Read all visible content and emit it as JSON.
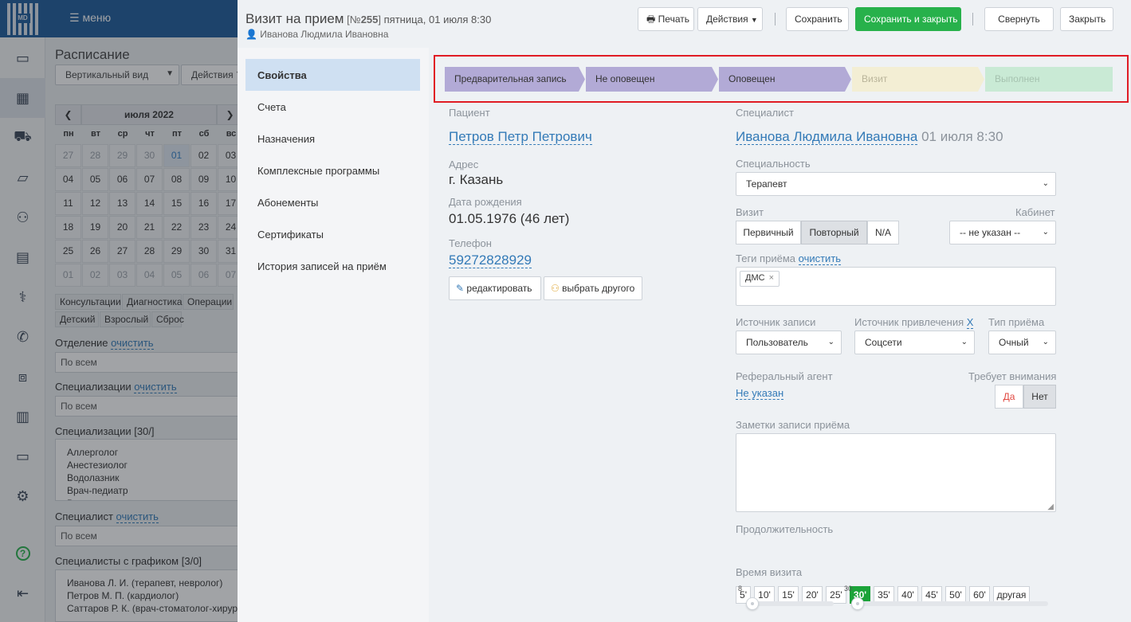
{
  "app": {
    "logo_text": "MD",
    "menu_label": "меню",
    "rail_icons": [
      "monitor-icon",
      "calendar-icon",
      "ambulance-icon",
      "banknote-icon",
      "users-icon",
      "book-icon",
      "stethoscope-icon",
      "phone-icon",
      "briefcase-icon",
      "chart-icon",
      "folder-icon",
      "gear-icon",
      "help-icon",
      "logout-icon"
    ]
  },
  "schedule": {
    "title": "Расписание",
    "view_select": "Вертикальный вид",
    "actions_select": "Действия",
    "calendar": {
      "month": "июля 2022",
      "weekdays": [
        "пн",
        "вт",
        "ср",
        "чт",
        "пт",
        "сб",
        "вс"
      ],
      "days": [
        [
          "27",
          "28",
          "29",
          "30",
          "01",
          "02",
          "03"
        ],
        [
          "04",
          "05",
          "06",
          "07",
          "08",
          "09",
          "10"
        ],
        [
          "11",
          "12",
          "13",
          "14",
          "15",
          "16",
          "17"
        ],
        [
          "18",
          "19",
          "20",
          "21",
          "22",
          "23",
          "24"
        ],
        [
          "25",
          "26",
          "27",
          "28",
          "29",
          "30",
          "31"
        ],
        [
          "01",
          "02",
          "03",
          "04",
          "05",
          "06",
          "07"
        ]
      ]
    },
    "chips_row1": [
      "Консультации",
      "Диагностика",
      "Операции"
    ],
    "chips_row2": [
      "Детский",
      "Взрослый",
      "Сброс"
    ],
    "department_label": "Отделение",
    "clear_label": "очистить",
    "department_value": "По всем",
    "specializations_label": "Специализации",
    "specializations_value": "По всем",
    "specializations_list_label": "Специализации [30/]",
    "specializations_list": [
      "Аллерголог",
      "Анестезиолог",
      "Водолазник",
      "Врач-педиатр",
      "Врач-стоматолог-хирург"
    ],
    "specialist_label": "Специалист",
    "specialist_value": "По всем",
    "specialists_schedule_label": "Специалисты с графиком [3/0]",
    "specialists_list": [
      "Иванова Л. И. (терапевт, невролог)",
      "Петров М. П. (кардиолог)",
      "Саттаров Р. К. (врач-стоматолог-хирург)"
    ]
  },
  "modal": {
    "title": "Визит на прием",
    "number_prefix": "[№",
    "number": "255",
    "number_suffix": "]",
    "date": "пятница, 01 июля 8:30",
    "doctor_subtitle": "Иванова Людмила Ивановна",
    "buttons": {
      "print": "Печать",
      "actions": "Действия",
      "save": "Сохранить",
      "save_close": "Сохранить и закрыть",
      "collapse": "Свернуть",
      "close": "Закрыть"
    },
    "nav": [
      "Свойства",
      "Счета",
      "Назначения",
      "Комплексные программы",
      "Абонементы",
      "Сертификаты",
      "История записей на приём"
    ],
    "stages": [
      {
        "label": "Предварительная запись",
        "color": "#b2aad6",
        "text_color": "#333333"
      },
      {
        "label": "Не оповещен",
        "color": "#b2aad6",
        "text_color": "#333333"
      },
      {
        "label": "Оповещен",
        "color": "#b2aad6",
        "text_color": "#333333"
      },
      {
        "label": "Визит",
        "color": "#f3eed4",
        "text_color": "#b9b49a"
      },
      {
        "label": "Выполнен",
        "color": "#c9ead5",
        "text_color": "#a5c2af"
      }
    ],
    "patient": {
      "label": "Пациент",
      "name": "Петров Петр Петрович",
      "address_label": "Адрес",
      "address": "г. Казань",
      "birth_label": "Дата рождения",
      "birth": "01.05.1976 (46 лет)",
      "phone_label": "Телефон",
      "phone": "59272828929",
      "edit_button": "редактировать",
      "choose_button": "выбрать другого"
    },
    "specialist": {
      "label": "Специалист",
      "name": "Иванова Людмила Ивановна",
      "time": "01 июля 8:30",
      "specialty_label": "Специальность",
      "specialty": "Терапевт",
      "visit_label": "Визит",
      "visit_options": [
        "Первичный",
        "Повторный",
        "N/A"
      ],
      "visit_selected": "Повторный",
      "cabinet_label": "Кабинет",
      "cabinet": "-- не указан --",
      "tags_label": "Теги приёма",
      "tags_clear": "очистить",
      "tags": [
        "ДМС"
      ],
      "source_label": "Источник записи",
      "source": "Пользователь",
      "attraction_label": "Источник привлечения",
      "attraction_clear": "X",
      "attraction": "Соцсети",
      "type_label": "Тип приёма",
      "type": "Очный",
      "referral_label": "Реферальный агент",
      "referral": "Не указан",
      "attention_label": "Требует внимания",
      "attention_yes": "Да",
      "attention_no": "Нет",
      "notes_label": "Заметки записи приёма",
      "duration_label": "Продолжительность",
      "durations": [
        "5'",
        "10'",
        "15'",
        "20'",
        "25'",
        "30'",
        "35'",
        "40'",
        "45'",
        "50'",
        "60'",
        "другая"
      ],
      "duration_selected": "30'",
      "visit_time_label": "Время визита",
      "slider_a": "8",
      "slider_b": "30"
    },
    "colors": {
      "accent": "#337ab7",
      "green": "#27b14b",
      "highlight": "#e01b24"
    }
  }
}
